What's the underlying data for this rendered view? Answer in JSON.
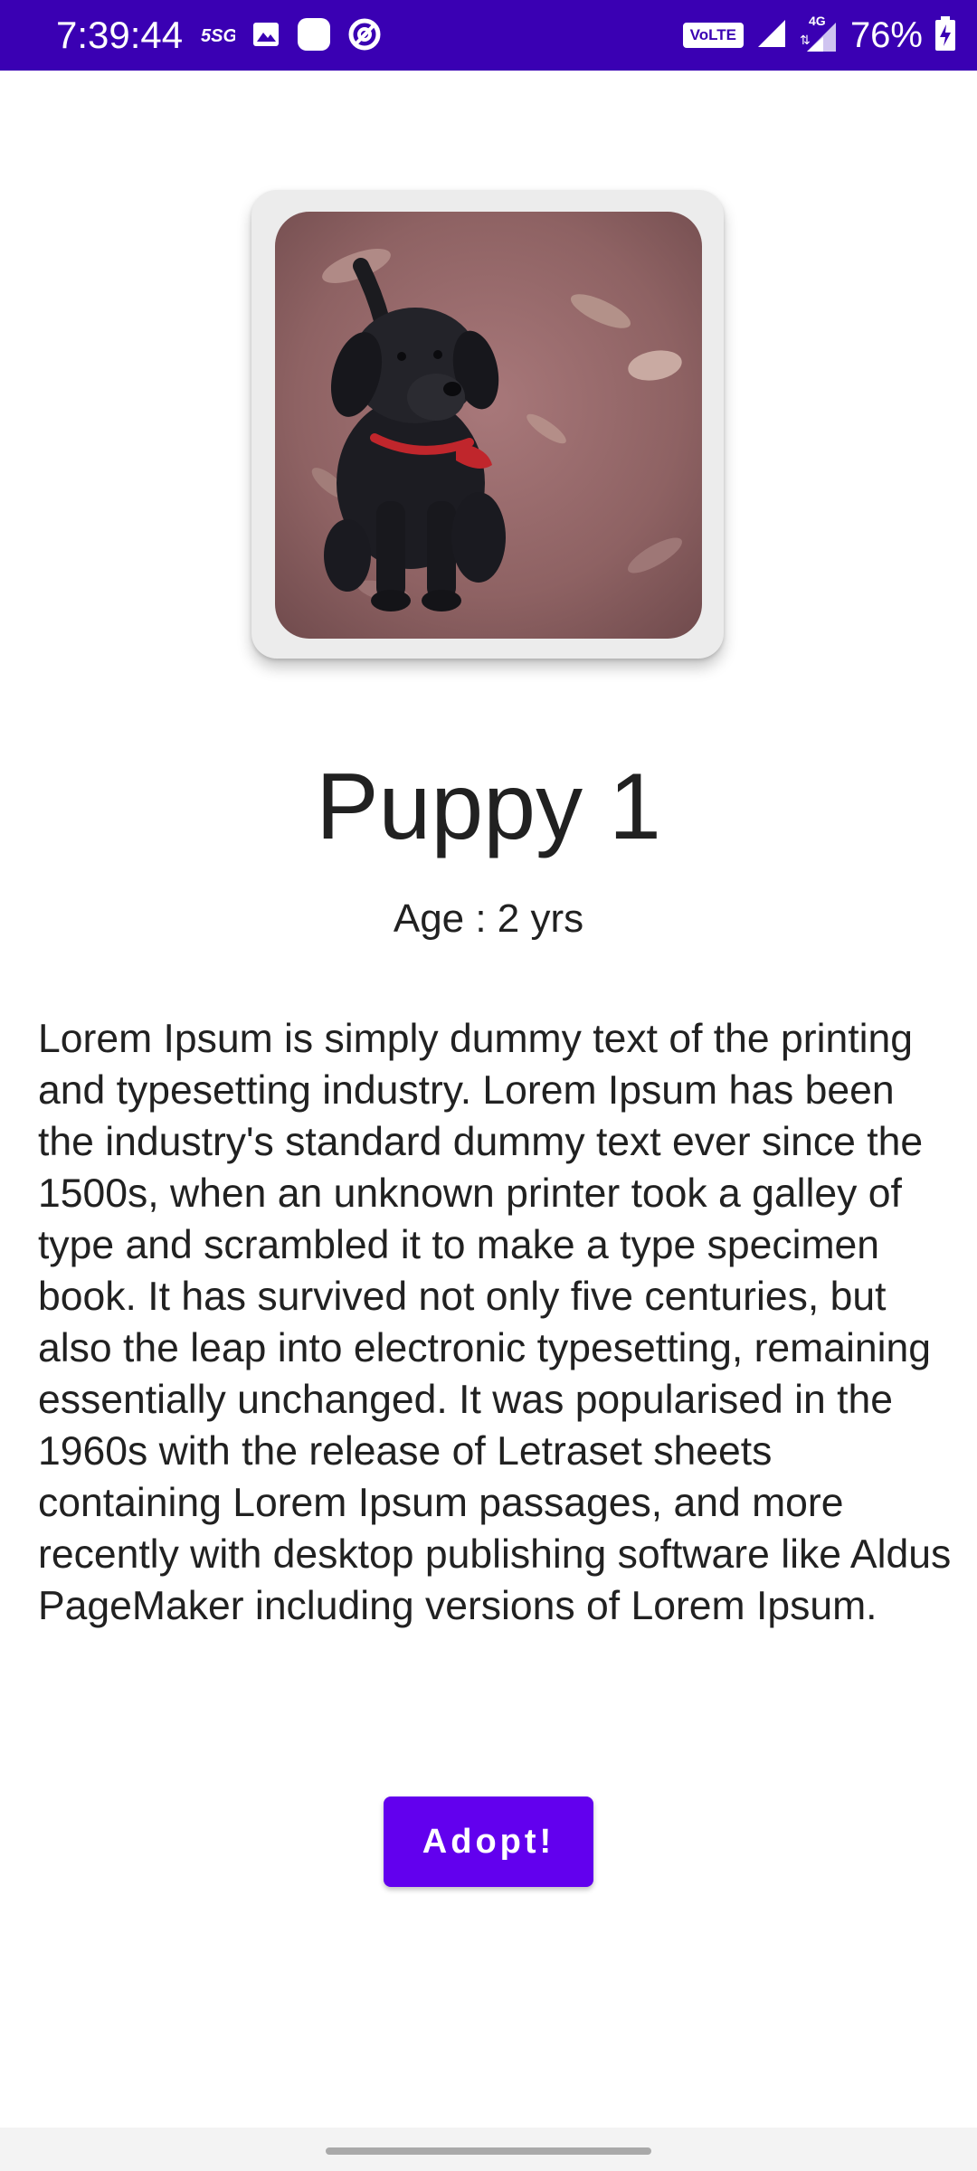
{
  "status_bar": {
    "time": "7:39:44",
    "left_icons": [
      "5g-sim-icon",
      "image-icon",
      "app-icon",
      "data-saver-icon"
    ],
    "volte_label": "VoLTE",
    "network_label": "4G",
    "battery_percent": "76%",
    "background_color": "#3a00b3"
  },
  "pet": {
    "name": "Puppy 1",
    "age_label": "Age : 2 yrs",
    "photo_icon": "puppy-photo",
    "description": "Lorem Ipsum is simply dummy text of the printing and typesetting industry. Lorem Ipsum has been the industry's standard dummy text ever since the 1500s, when an unknown printer took a galley of type and scrambled it to make a type specimen book. It has survived not only five centuries, but also the leap into electronic typesetting, remaining essentially unchanged. It was popularised in the 1960s with the release of Letraset sheets containing Lorem Ipsum passages, and more recently with desktop publishing software like Aldus PageMaker including versions of Lorem Ipsum."
  },
  "actions": {
    "adopt_label": "Adopt!",
    "accent_color": "#6200ee"
  }
}
